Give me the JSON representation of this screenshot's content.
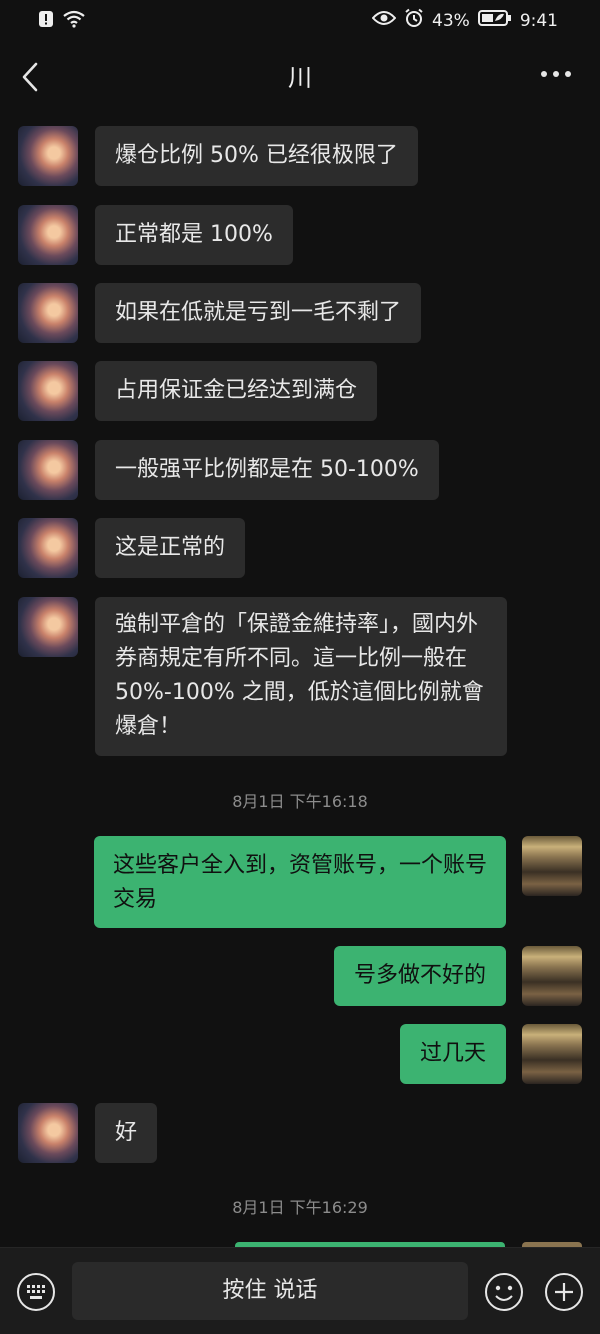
{
  "status_bar": {
    "battery_percent": "43%",
    "time": "9:41"
  },
  "header": {
    "title": "川"
  },
  "messages": [
    {
      "side": "in",
      "text": "爆仓比例 50% 已经很极限了"
    },
    {
      "side": "in",
      "text": "正常都是 100%"
    },
    {
      "side": "in",
      "text": "如果在低就是亏到一毛不剩了"
    },
    {
      "side": "in",
      "text": "占用保证金已经达到满仓"
    },
    {
      "side": "in",
      "text": "一般强平比例都是在 50-100%"
    },
    {
      "side": "in",
      "text": "这是正常的"
    },
    {
      "side": "in",
      "text": "強制平倉的「保證金維持率」，國内外券商規定有所不同。這一比例一般在 50%-100% 之間，低於這個比例就會爆倉！"
    },
    {
      "side": "out",
      "text": "这些客户全入到，资管账号，一个账号交易"
    },
    {
      "side": "out",
      "text": "号多做不好的"
    },
    {
      "side": "out",
      "text": "过几天"
    },
    {
      "side": "in",
      "text": "好"
    }
  ],
  "timestamps": [
    "8月1日 下午16:18",
    "8月1日 下午16:29"
  ],
  "input_bar": {
    "voice_label": "按住 说话"
  },
  "icons": {
    "back": "back-arrow-icon",
    "more": "more-dots-icon",
    "keyboard": "keyboard-icon",
    "emoji": "emoji-icon",
    "plus": "plus-icon"
  },
  "colors": {
    "background": "#111111",
    "incoming_bubble": "#2c2c2c",
    "outgoing_bubble": "#3cb371"
  }
}
